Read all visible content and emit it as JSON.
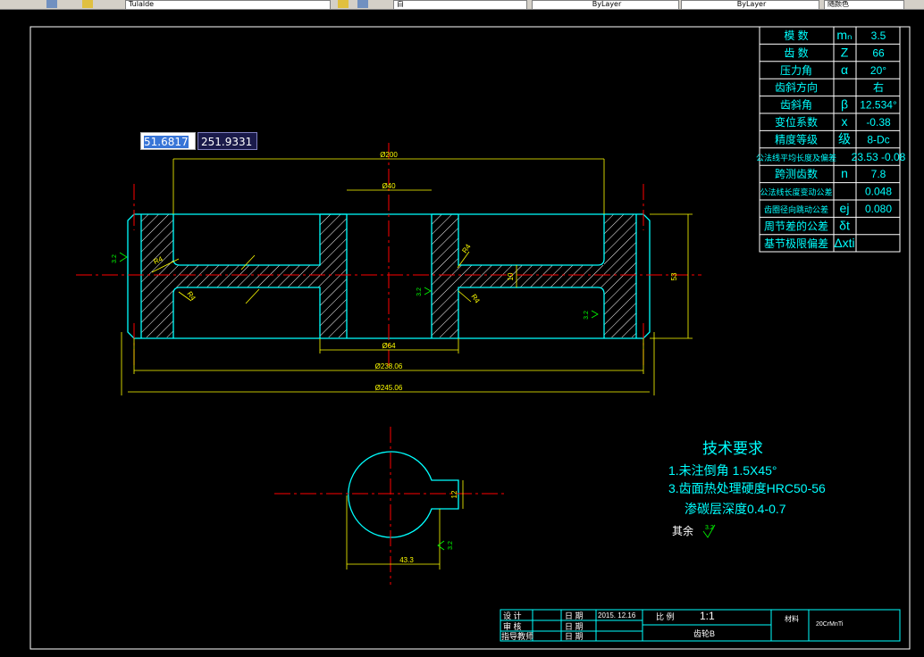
{
  "toolbar": {
    "layer_name": "Tulalde",
    "layer_current": "白",
    "linetype": "ByLayer",
    "lineweight": "ByLayer",
    "plotstyle": "随颜色"
  },
  "dynamic_input": {
    "x": "51.6817",
    "y": "251.9331"
  },
  "params_table": [
    {
      "label": "模  数",
      "sym": "mₙ",
      "val": "3.5"
    },
    {
      "label": "齿  数",
      "sym": "Z",
      "val": "66"
    },
    {
      "label": "压力角",
      "sym": "α",
      "val": "20°"
    },
    {
      "label": "齿斜方向",
      "sym": "",
      "val": "右"
    },
    {
      "label": "齿斜角",
      "sym": "β",
      "val": "12.534°"
    },
    {
      "label": "变位系数",
      "sym": "x",
      "val": "-0.38"
    },
    {
      "label": "精度等级",
      "sym": "级",
      "val": "8-Dc"
    },
    {
      "label": "公法线平均长度及偏差",
      "sym": "",
      "val": "23.53 -0.08"
    },
    {
      "label": "跨测齿数",
      "sym": "n",
      "val": "7.8"
    },
    {
      "label": "公法线长度变动公差",
      "sym": "",
      "val": "0.048"
    },
    {
      "label": "齿圈径向跳动公差",
      "sym": "ej",
      "val": "0.080"
    },
    {
      "label": "周节差的公差",
      "sym": "δt",
      "val": ""
    },
    {
      "label": "基节极限偏差",
      "sym": "Δxti",
      "val": ""
    }
  ],
  "dimensions": {
    "d200": "Ø200",
    "d40": "Ø40",
    "d64": "Ø64",
    "d238": "Ø238.06",
    "d245": "Ø245.06",
    "h53": "53",
    "w10": "10",
    "r4": "R4",
    "w43": "43.3",
    "h12": "12",
    "rough": "3.2"
  },
  "tech": {
    "title": "技术要求",
    "line1": "1.未注倒角  1.5X45°",
    "line2": "3.齿面热处理硬度HRC50-56",
    "line3": "渗碳层深度0.4-0.7",
    "rest": "其余"
  },
  "title_block": {
    "design": "设 计",
    "review": "审 核",
    "guide": "指导教师",
    "date_label": "日 期",
    "date": "2015. 12.16",
    "scale_label": "比 例",
    "scale": "1:1",
    "name": "齿轮B",
    "material_label": "材料",
    "material": "20CrMnTi"
  },
  "colors": {
    "cyan": "#00ffff",
    "yellow": "#ffff00",
    "red": "#ff0000",
    "green": "#00ff00",
    "white": "#ffffff"
  }
}
